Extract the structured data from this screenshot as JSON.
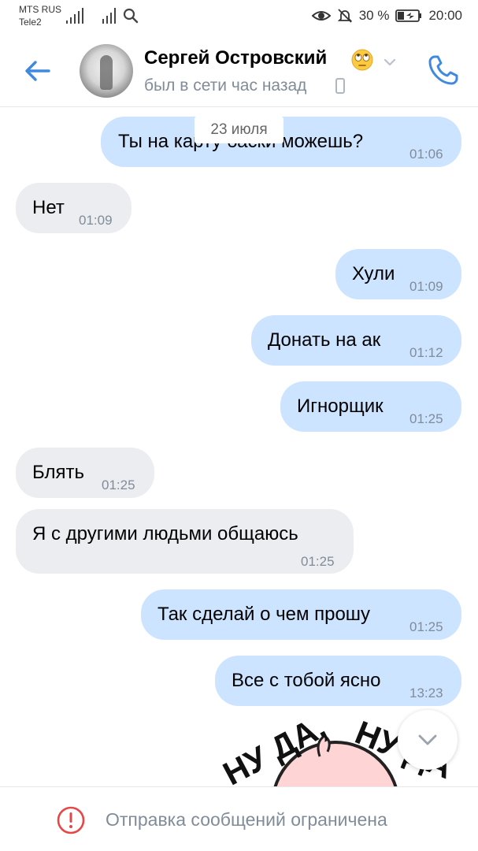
{
  "status_bar": {
    "carrier1": "MTS RUS",
    "carrier2": "Tele2",
    "battery": "30 %",
    "time": "20:00"
  },
  "header": {
    "name": "Сергей Островский",
    "emoji": "eye-roll-emoji",
    "presence": "был в сети час назад"
  },
  "chat": {
    "date": "23 июля",
    "messages": [
      {
        "dir": "out",
        "text": "Ты на карту баски можешь?",
        "time": "01:06"
      },
      {
        "dir": "in",
        "text": "Нет",
        "time": "01:09"
      },
      {
        "dir": "out",
        "text": "Хули",
        "time": "01:09"
      },
      {
        "dir": "out",
        "text": "Донать на ак",
        "time": "01:12"
      },
      {
        "dir": "out",
        "text": "Игнорщик",
        "time": "01:25"
      },
      {
        "dir": "in",
        "text": "Блять",
        "time": "01:25"
      },
      {
        "dir": "in",
        "text": "Я с другими людьми общаюсь",
        "time": "01:25"
      },
      {
        "dir": "out",
        "text": "Так сделай о чем прошу",
        "time": "01:25"
      },
      {
        "dir": "out",
        "text": "Все с тобой ясно",
        "time": "13:23"
      }
    ],
    "sticker": {
      "text1": "НУ ДА,",
      "text2": "НУ ДА"
    }
  },
  "bottom": {
    "restricted": "Отправка сообщений ограничена"
  },
  "colors": {
    "accent": "#3f8ae0",
    "outgoing": "#cce4ff",
    "incoming": "#ebedf0",
    "muted": "#818c99",
    "warning": "#e64646"
  }
}
